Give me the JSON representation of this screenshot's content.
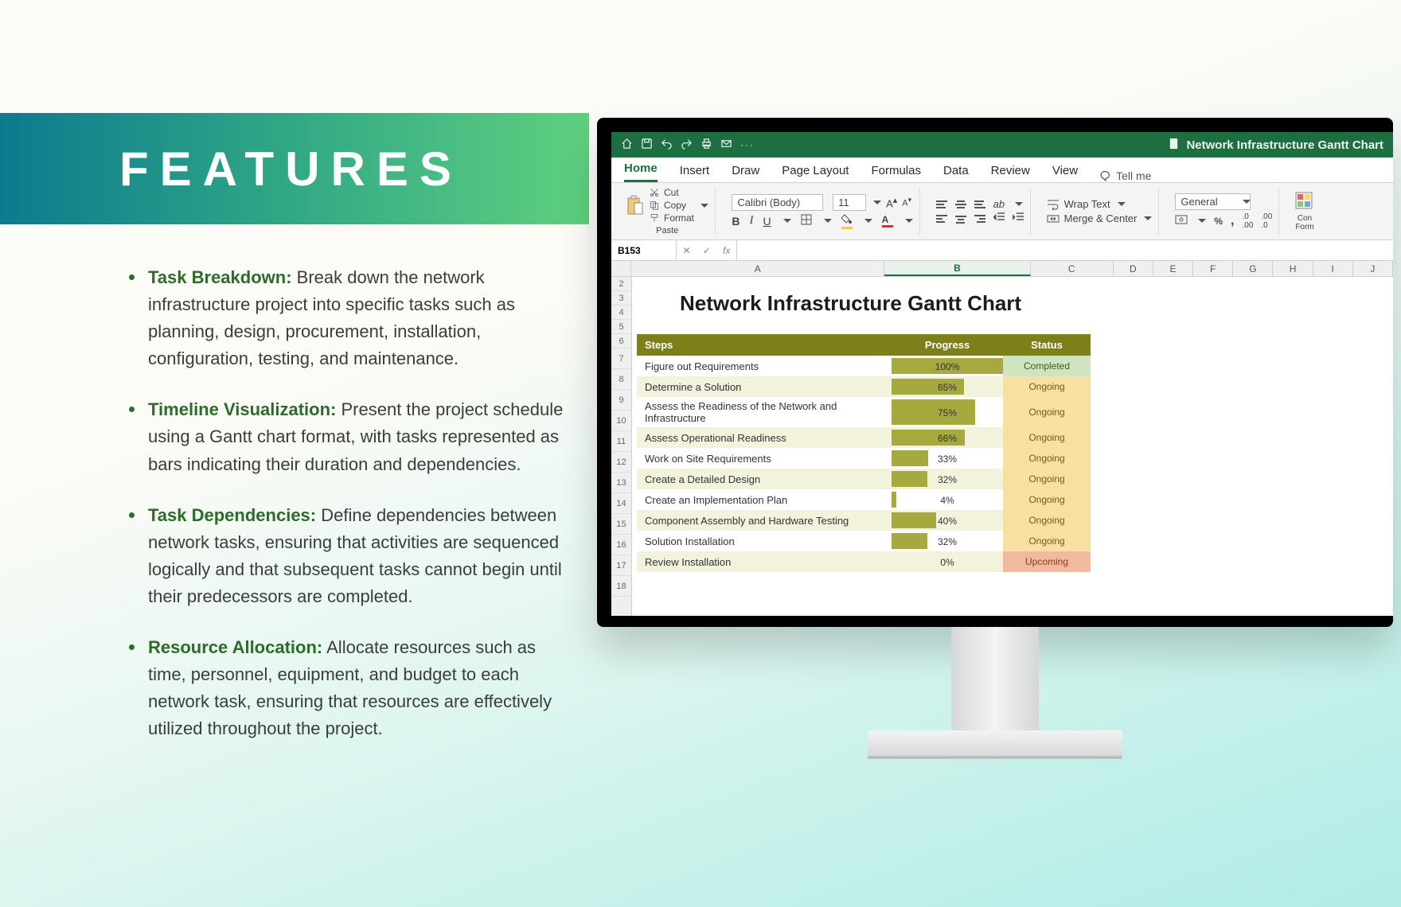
{
  "banner": {
    "title": "FEATURES"
  },
  "features": [
    {
      "label": "Task Breakdown:",
      "text": " Break down the network infrastructure project into specific tasks such as planning, design, procurement, installation, configuration, testing, and maintenance."
    },
    {
      "label": "Timeline Visualization:",
      "text": " Present the project schedule using a Gantt chart format, with tasks represented as bars indicating their duration and dependencies."
    },
    {
      "label": "Task Dependencies:",
      "text": " Define dependencies between network tasks, ensuring that activities are sequenced logically and that subsequent tasks cannot begin until their predecessors are completed."
    },
    {
      "label": "Resource Allocation:",
      "text": " Allocate resources such as time, personnel, equipment, and budget to each network task, ensuring that resources are effectively utilized throughout the project."
    }
  ],
  "excel": {
    "doc_title": "Network Infrastructure Gantt Chart",
    "tabs": [
      "Home",
      "Insert",
      "Draw",
      "Page Layout",
      "Formulas",
      "Data",
      "Review",
      "View"
    ],
    "tellme": "Tell me",
    "clipboard": {
      "paste": "Paste",
      "cut": "Cut",
      "copy": "Copy",
      "format": "Format"
    },
    "font": {
      "name": "Calibri (Body)",
      "size": "11"
    },
    "align": {
      "wrap": "Wrap Text",
      "merge": "Merge & Center"
    },
    "number": {
      "format": "General",
      "cond": "Conditional Formatting"
    },
    "name_box": "B153",
    "fx": "fx",
    "columns": [
      "A",
      "B",
      "C",
      "D",
      "E",
      "F",
      "G",
      "H",
      "I",
      "J"
    ],
    "row_numbers": [
      "2",
      "3",
      "4",
      "5",
      "6",
      "7",
      "8",
      "9",
      "10",
      "11",
      "12",
      "13",
      "14",
      "15",
      "16",
      "17",
      "18"
    ],
    "chart_title": "Network Infrastructure Gantt Chart",
    "headers": {
      "steps": "Steps",
      "progress": "Progress",
      "status": "Status"
    },
    "statuses": {
      "completed": "Completed",
      "ongoing": "Ongoing",
      "upcoming": "Upcoming"
    }
  },
  "chart_data": {
    "type": "table",
    "title": "Network Infrastructure Gantt Chart",
    "columns": [
      "Steps",
      "Progress",
      "Status"
    ],
    "rows": [
      {
        "step": "Figure out Requirements",
        "progress": 100,
        "progress_label": "100%",
        "status": "Completed"
      },
      {
        "step": "Determine a Solution",
        "progress": 65,
        "progress_label": "65%",
        "status": "Ongoing"
      },
      {
        "step": "Assess the Readiness of the Network and Infrastructure",
        "progress": 75,
        "progress_label": "75%",
        "status": "Ongoing"
      },
      {
        "step": "Assess Operational Readiness",
        "progress": 66,
        "progress_label": "66%",
        "status": "Ongoing"
      },
      {
        "step": "Work on Site Requirements",
        "progress": 33,
        "progress_label": "33%",
        "status": "Ongoing"
      },
      {
        "step": "Create a Detailed Design",
        "progress": 32,
        "progress_label": "32%",
        "status": "Ongoing"
      },
      {
        "step": "Create an Implementation Plan",
        "progress": 4,
        "progress_label": "4%",
        "status": "Ongoing"
      },
      {
        "step": "Component Assembly and Hardware Testing",
        "progress": 40,
        "progress_label": "40%",
        "status": "Ongoing"
      },
      {
        "step": "Solution Installation",
        "progress": 32,
        "progress_label": "32%",
        "status": "Ongoing"
      },
      {
        "step": "Review Installation",
        "progress": 0,
        "progress_label": "0%",
        "status": "Upcoming"
      }
    ]
  }
}
